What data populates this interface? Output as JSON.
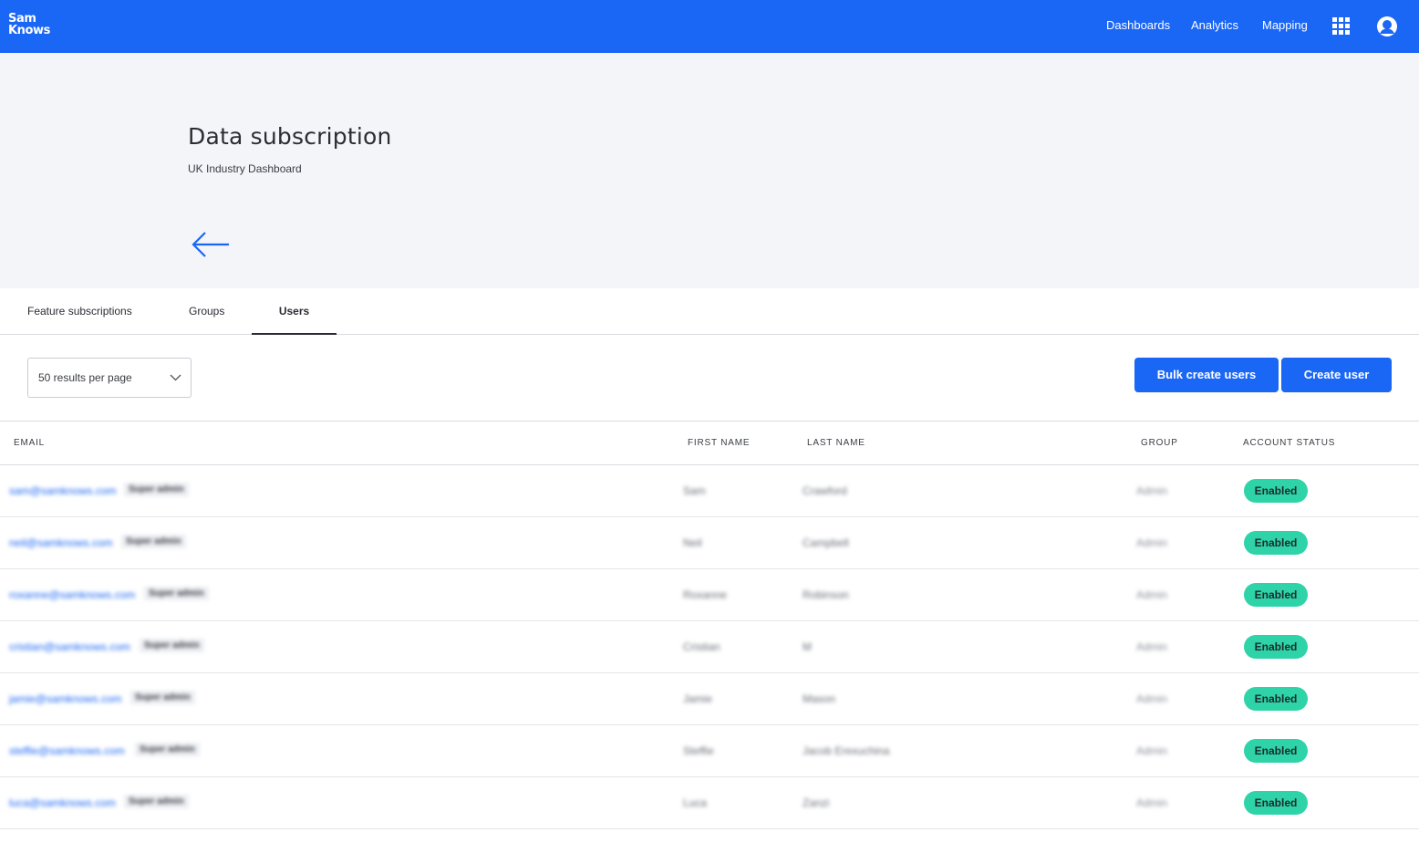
{
  "header": {
    "logo_line1": "Sam",
    "logo_line2": "Knows",
    "nav": [
      "Dashboards",
      "Analytics",
      "Mapping"
    ],
    "brand_color": "#1a66f5"
  },
  "page": {
    "title": "Data subscription",
    "subtitle": "UK Industry Dashboard"
  },
  "tabs": [
    "Feature subscriptions",
    "Groups",
    "Users"
  ],
  "active_tab": "Users",
  "controls": {
    "per_page": "50 results per page",
    "bulk_create": "Bulk create users",
    "create": "Create user"
  },
  "table": {
    "columns": [
      "EMAIL",
      "FIRST NAME",
      "LAST NAME",
      "GROUP",
      "ACCOUNT STATUS"
    ],
    "rows": [
      {
        "email": "sam@samknows.com",
        "role": "Super admin",
        "first": "Sam",
        "last": "Crawford",
        "group": "Admin",
        "status": "Enabled"
      },
      {
        "email": "neil@samknows.com",
        "role": "Super admin",
        "first": "Neil",
        "last": "Campbell",
        "group": "Admin",
        "status": "Enabled"
      },
      {
        "email": "roxanne@samknows.com",
        "role": "Super admin",
        "first": "Roxanne",
        "last": "Robinson",
        "group": "Admin",
        "status": "Enabled"
      },
      {
        "email": "cristian@samknows.com",
        "role": "Super admin",
        "first": "Cristian",
        "last": "M",
        "group": "Admin",
        "status": "Enabled"
      },
      {
        "email": "jamie@samknows.com",
        "role": "Super admin",
        "first": "Jamie",
        "last": "Mason",
        "group": "Admin",
        "status": "Enabled"
      },
      {
        "email": "steffie@samknows.com",
        "role": "Super admin",
        "first": "Steffie",
        "last": "Jacob Erexuchina",
        "group": "Admin",
        "status": "Enabled"
      },
      {
        "email": "luca@samknows.com",
        "role": "Super admin",
        "first": "Luca",
        "last": "Zanzi",
        "group": "Admin",
        "status": "Enabled"
      }
    ]
  },
  "colors": {
    "status_enabled": "#2ed3a8",
    "hero_bg": "#f4f5f8"
  }
}
